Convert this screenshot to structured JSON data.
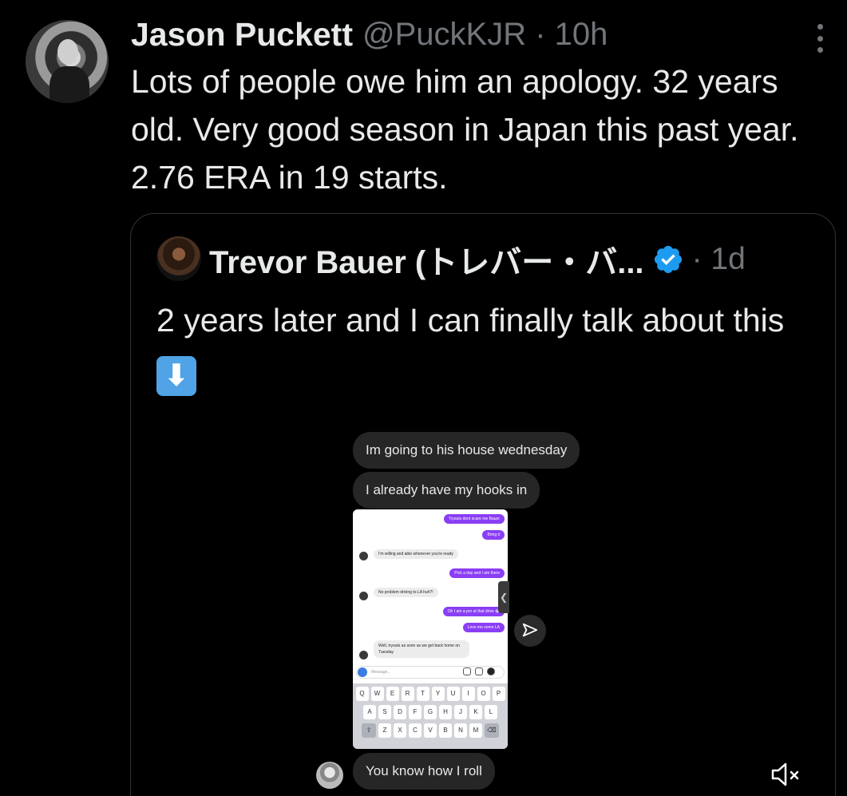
{
  "tweet": {
    "author_name": "Jason Puckett",
    "handle_time": "@PuckKJR · 10h",
    "text": "Lots of people owe him an apology. 32 years old. Very good season in Japan this past year. 2.76 ERA in 19 starts."
  },
  "quote": {
    "author_name": "Trevor Bauer (トレバー・バ...",
    "time": "· 1d",
    "text": "2 years later and I can finally talk about this",
    "emoji": "⬇"
  },
  "media": {
    "bubble_1": "Im going to his house wednesday",
    "bubble_2": "I already have my hooks in",
    "bubble_3": "You know how I roll",
    "phone_messages": [
      "Tryouts dont scare me Bauer",
      "Bring it",
      "I'm willing and able whenever you're ready",
      "Pick a day and I am there",
      "No problem driving to LA huh?!",
      "Oh I am a pro at that drive 😂",
      "Love me some LA",
      "Well, tryouts as soon as we get back home on Tuesday"
    ],
    "phone_input_placeholder": "Message...",
    "keyboard_row_1": [
      "Q",
      "W",
      "E",
      "R",
      "T",
      "Y",
      "U",
      "I",
      "O",
      "P"
    ],
    "keyboard_row_2": [
      "A",
      "S",
      "D",
      "F",
      "G",
      "H",
      "J",
      "K",
      "L"
    ],
    "keyboard_row_3": [
      "Z",
      "X",
      "C",
      "V",
      "B",
      "N",
      "M"
    ],
    "side_tab": "❮"
  },
  "colors": {
    "verified": "#1d9bf0",
    "purple_message": "#8a3ef5",
    "muted_text": "#71767b"
  }
}
